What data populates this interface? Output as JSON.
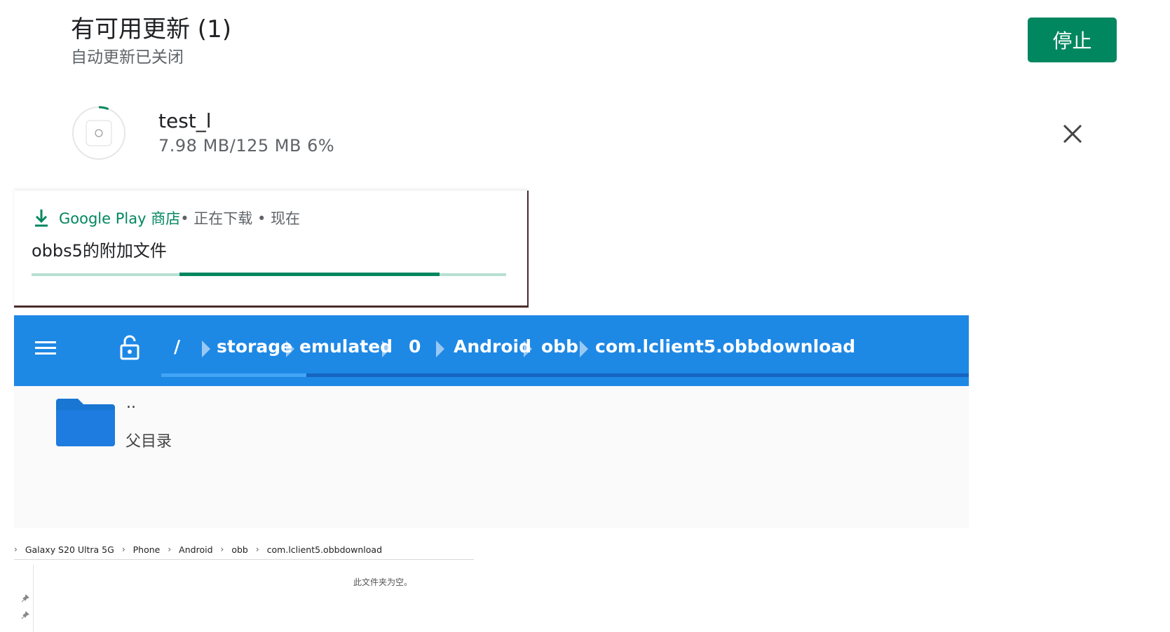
{
  "play_updates": {
    "title": "有可用更新 (1)",
    "subtitle": "自动更新已关闭",
    "stop_label": "停止",
    "app_name": "test_l",
    "app_progress": "7.98 MB/125 MB  6%",
    "progress_fraction": 0.06
  },
  "notification": {
    "app_name": "Google Play 商店",
    "meta": " • 正在下载 • 现在",
    "title": "obbs5的附加文件"
  },
  "file_manager": {
    "path": [
      "/",
      "storage",
      "emulated",
      "0",
      "Android",
      "obb",
      "com.lclient5.obbdownload"
    ],
    "parent_dots": "..",
    "parent_label": "父目录"
  },
  "explorer": {
    "path": [
      "Galaxy S20 Ultra 5G",
      "Phone",
      "Android",
      "obb",
      "com.lclient5.obbdownload"
    ],
    "empty_message": "此文件夹为空。"
  },
  "colors": {
    "play_green": "#01875f",
    "fm_blue": "#1e88e5",
    "folder_blue": "#1976d2"
  }
}
